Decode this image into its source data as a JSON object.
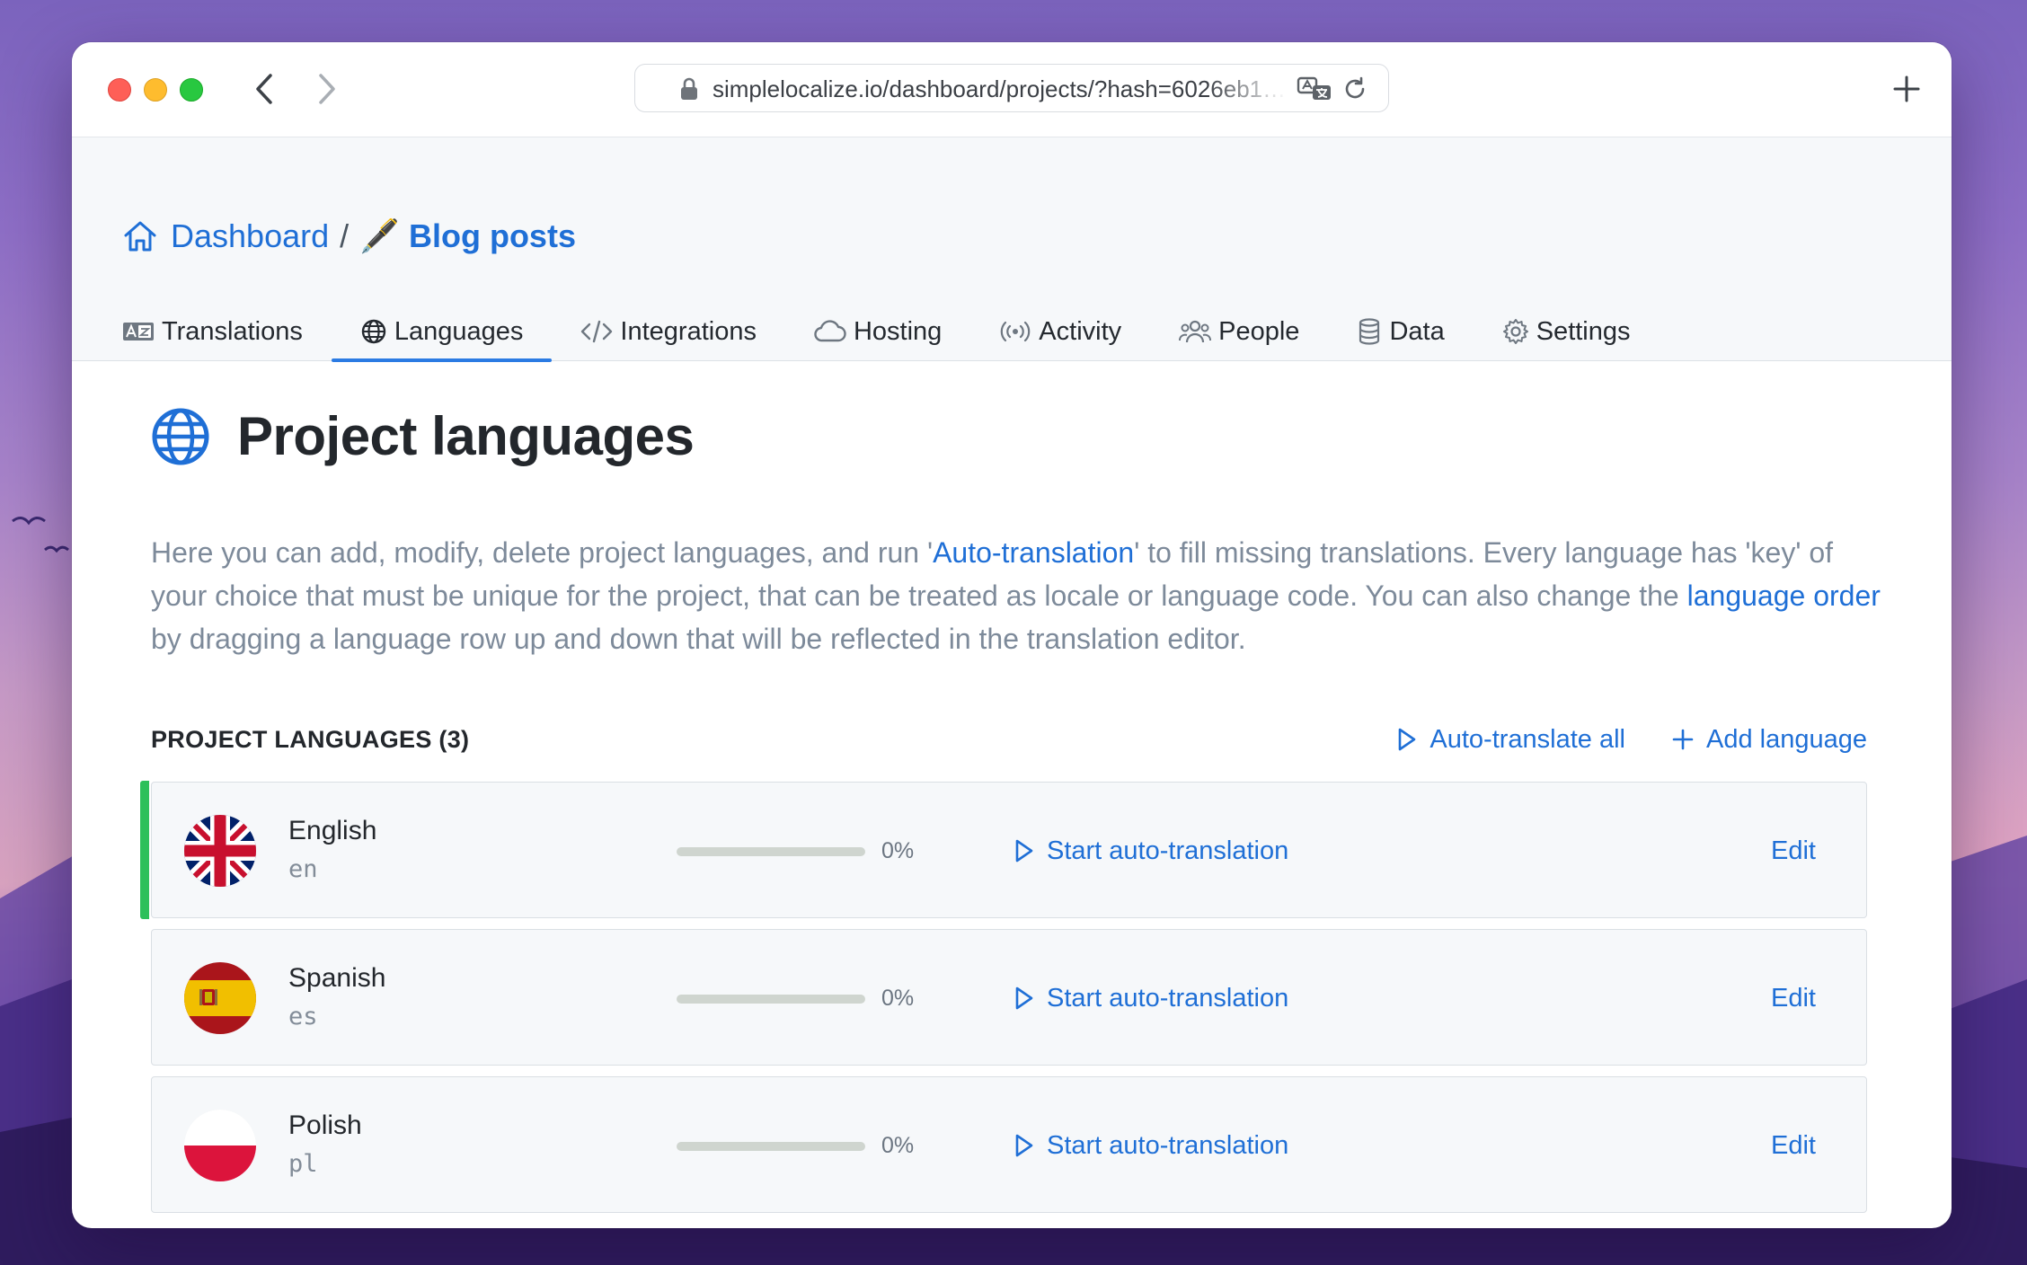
{
  "browser": {
    "url": "simplelocalize.io/dashboard/projects/?hash=6026eb1…",
    "icons": [
      "back-icon",
      "forward-icon",
      "lock-icon",
      "translate-icon",
      "reload-icon",
      "plus-icon"
    ]
  },
  "breadcrumb": {
    "home": "Dashboard",
    "separator": "/",
    "current_emoji": "🖋️",
    "current": "Blog posts"
  },
  "tabs": [
    {
      "label": "Translations",
      "icon": "translations-icon",
      "active": false
    },
    {
      "label": "Languages",
      "icon": "globe-icon",
      "active": true
    },
    {
      "label": "Integrations",
      "icon": "code-icon",
      "active": false
    },
    {
      "label": "Hosting",
      "icon": "cloud-icon",
      "active": false
    },
    {
      "label": "Activity",
      "icon": "broadcast-icon",
      "active": false
    },
    {
      "label": "People",
      "icon": "people-icon",
      "active": false
    },
    {
      "label": "Data",
      "icon": "database-icon",
      "active": false
    },
    {
      "label": "Settings",
      "icon": "gear-icon",
      "active": false
    }
  ],
  "page": {
    "title": "Project languages",
    "desc_1": "Here you can add, modify, delete project languages, and run '",
    "desc_link_1": "Auto-translation",
    "desc_2": "' to fill missing translations. Every language has 'key' of your choice that must be unique for the project, that can be treated as locale or language code. You can also change the ",
    "desc_link_2": "language order",
    "desc_3": " by dragging a language row up and down that will be reflected in the translation editor."
  },
  "section": {
    "label": "PROJECT LANGUAGES (3)",
    "auto_translate_all": "Auto-translate all",
    "add_language": "Add language"
  },
  "languages": [
    {
      "name": "English",
      "code": "en",
      "progress": 0,
      "progress_label": "0%",
      "action": "Start auto-translation",
      "edit": "Edit",
      "flag": "uk-flag-icon",
      "selected": true
    },
    {
      "name": "Spanish",
      "code": "es",
      "progress": 0,
      "progress_label": "0%",
      "action": "Start auto-translation",
      "edit": "Edit",
      "flag": "spain-flag-icon",
      "selected": false
    },
    {
      "name": "Polish",
      "code": "pl",
      "progress": 0,
      "progress_label": "0%",
      "action": "Start auto-translation",
      "edit": "Edit",
      "flag": "poland-flag-icon",
      "selected": false
    }
  ],
  "colors": {
    "accent": "#1f6fd6",
    "active_tab_underline": "#2b7be3",
    "selected_row_marker": "#2cc05a"
  }
}
